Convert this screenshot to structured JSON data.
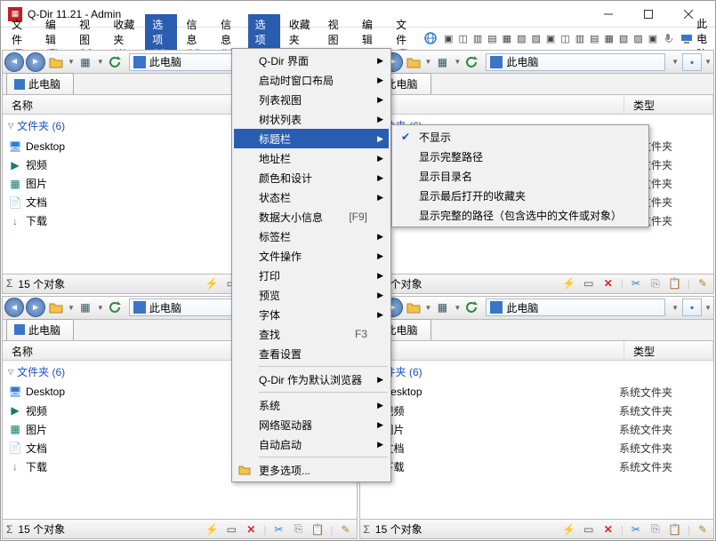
{
  "title": "Q-Dir 11.21 - Admin",
  "menubar": [
    "文件 (F)",
    "编辑 (E)",
    "视图 (V)",
    "收藏夹 (A)",
    "选项 (X)",
    "信息 (H)"
  ],
  "right_label": "此电脑",
  "pane": {
    "addr": "此电脑",
    "tab": "此电脑",
    "cols": {
      "name": "名称",
      "val": "类型"
    },
    "group": "文件夹 (6)",
    "rows": [
      {
        "icon": "desktop",
        "name": "Desktop",
        "val": "系统文件夹"
      },
      {
        "icon": "video",
        "name": "视频",
        "val": "系统文件夹"
      },
      {
        "icon": "pic",
        "name": "图片",
        "val": "系统文件夹"
      },
      {
        "icon": "doc",
        "name": "文档",
        "val": "系统文件夹"
      },
      {
        "icon": "dl",
        "name": "下载",
        "val": "系统文件夹"
      }
    ],
    "status": "15 个对象"
  },
  "options_menu": [
    {
      "t": "Q-Dir 界面",
      "a": true
    },
    {
      "t": "启动时窗口布局",
      "a": true
    },
    {
      "t": "列表视图",
      "a": true
    },
    {
      "t": "树状列表",
      "a": true
    },
    {
      "t": "标题栏",
      "a": true,
      "hi": true
    },
    {
      "t": "地址栏",
      "a": true
    },
    {
      "t": "颜色和设计",
      "a": true
    },
    {
      "t": "状态栏",
      "a": true
    },
    {
      "t": "数据大小信息",
      "a": false,
      "s": "[F9]"
    },
    {
      "t": "标签栏",
      "a": true
    },
    {
      "t": "文件操作",
      "a": true
    },
    {
      "t": "打印",
      "a": true
    },
    {
      "t": "预览",
      "a": true
    },
    {
      "t": "字体",
      "a": true
    },
    {
      "t": "查找",
      "a": false,
      "s": "F3"
    },
    {
      "t": "查看设置"
    },
    {
      "sep": true
    },
    {
      "t": "Q-Dir 作为默认浏览器",
      "a": true
    },
    {
      "sep": true
    },
    {
      "t": "系统",
      "a": true
    },
    {
      "t": "网络驱动器",
      "a": true
    },
    {
      "t": "自动启动",
      "a": true
    },
    {
      "sep": true
    },
    {
      "t": "更多选项...",
      "i": "folder"
    }
  ],
  "title_submenu": [
    {
      "t": "不显示",
      "c": true
    },
    {
      "t": "显示完整路径"
    },
    {
      "t": "显示目录名"
    },
    {
      "t": "显示最后打开的收藏夹"
    },
    {
      "t": "显示完整的路径（包含选中的文件或对象）"
    }
  ]
}
